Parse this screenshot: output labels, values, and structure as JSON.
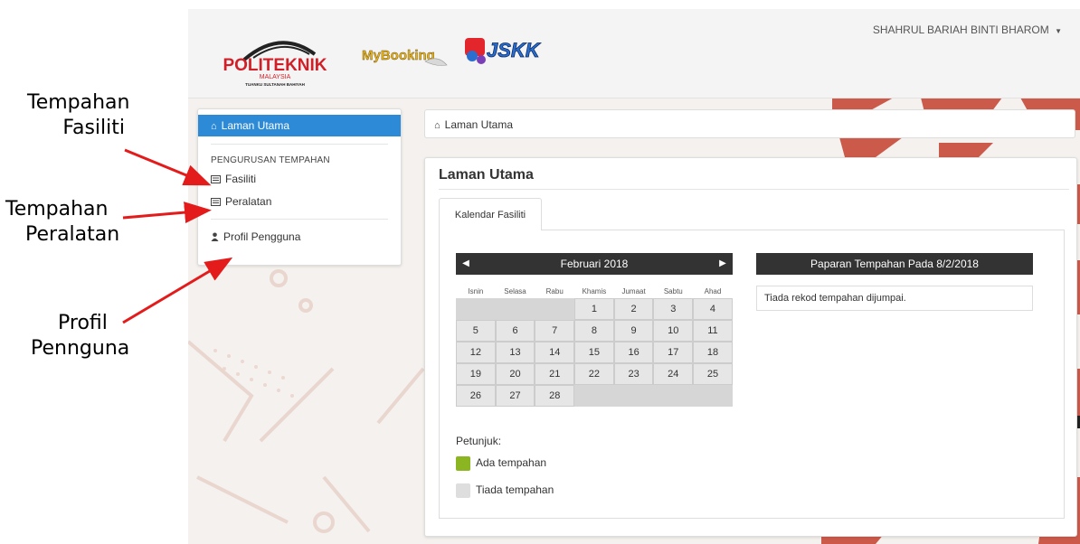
{
  "annotations": {
    "fasiliti": [
      "Tempahan",
      "Fasiliti"
    ],
    "peralatan": [
      "Tempahan",
      "Peralatan"
    ],
    "profil": [
      "Profil",
      "Pennguna"
    ]
  },
  "header": {
    "user_name": "SHAHRUL BARIAH BINTI BHAROM",
    "logo_poli": {
      "main": "POLITEKNIK",
      "sub": "MALAYSIA",
      "campus": "TUANKU SULTANAH BAHIYAH"
    },
    "logo_mybooking": "MyBooking",
    "logo_jskk": "JSKK"
  },
  "sidebar": {
    "home_label": "Laman Utama",
    "section_heading": "PENGURUSAN TEMPAHAN",
    "fasiliti_label": "Fasiliti",
    "peralatan_label": "Peralatan",
    "profile_label": "Profil Pengguna"
  },
  "breadcrumb": {
    "label": "Laman Utama"
  },
  "panel": {
    "title": "Laman Utama",
    "tab_label": "Kalendar Fasiliti"
  },
  "calendar": {
    "month_label": "Februari 2018",
    "days_of_week": [
      "Isnin",
      "Selasa",
      "Rabu",
      "Khamis",
      "Jumaat",
      "Sabtu",
      "Ahad"
    ],
    "weeks": [
      [
        "",
        "",
        "",
        "1",
        "2",
        "3",
        "4"
      ],
      [
        "5",
        "6",
        "7",
        "8",
        "9",
        "10",
        "11"
      ],
      [
        "12",
        "13",
        "14",
        "15",
        "16",
        "17",
        "18"
      ],
      [
        "19",
        "20",
        "21",
        "22",
        "23",
        "24",
        "25"
      ],
      [
        "26",
        "27",
        "28",
        "",
        "",
        "",
        ""
      ]
    ]
  },
  "legend": {
    "title": "Petunjuk:",
    "has_booking": "Ada tempahan",
    "no_booking": "Tiada tempahan",
    "has_booking_color": "#8bb521",
    "no_booking_color": "#dedede"
  },
  "day_view": {
    "title": "Paparan Tempahan Pada 8/2/2018",
    "empty_message": "Tiada rekod tempahan dijumpai."
  },
  "colors": {
    "accent": "#2d8ad6",
    "dark_header": "#333333",
    "arrow": "#e31b1b"
  }
}
